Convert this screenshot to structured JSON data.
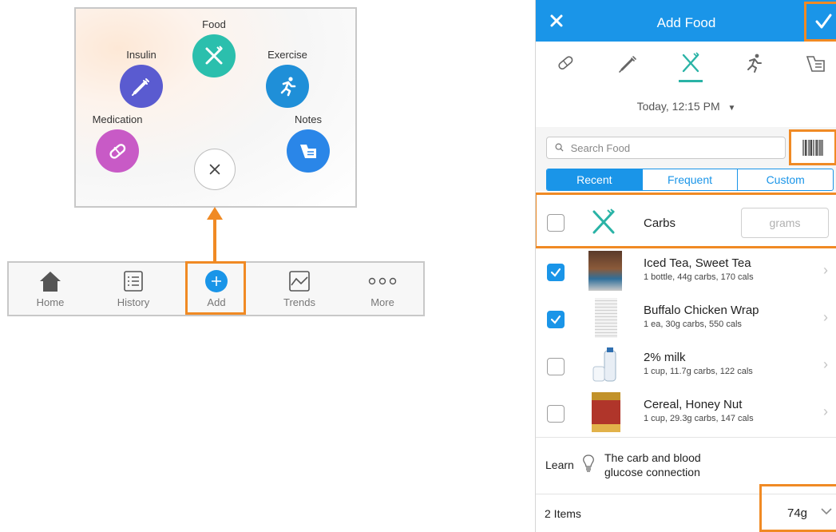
{
  "colors": {
    "accent_orange": "#f08a24",
    "nav_blue": "#1a95e8",
    "food_teal": "#2bbfad",
    "insulin_purple": "#5a5bd0",
    "exercise_blue": "#1f8fd8",
    "medication_pink": "#c85ac6",
    "notes_blue": "#2a86e8"
  },
  "add_menu": {
    "food_label": "Food",
    "food_icon": "fork-knife-icon",
    "insulin_label": "Insulin",
    "insulin_icon": "syringe-icon",
    "exercise_label": "Exercise",
    "exercise_icon": "runner-icon",
    "medication_label": "Medication",
    "medication_icon": "pill-icon",
    "notes_label": "Notes",
    "notes_icon": "notepad-icon",
    "close_icon": "close-icon"
  },
  "tab_bar": {
    "home": "Home",
    "history": "History",
    "add": "Add",
    "trends": "Trends",
    "more": "More"
  },
  "add_food": {
    "nav": {
      "title": "Add Food",
      "close_icon": "close-icon",
      "confirm_icon": "check-icon"
    },
    "categories": [
      "pill-icon",
      "syringe-icon",
      "fork-knife-icon",
      "runner-icon",
      "notepad-icon"
    ],
    "selected_category": "fork-knife-icon",
    "datetime": "Today, 12:15 PM",
    "search_placeholder": "Search Food",
    "segments": {
      "recent": "Recent",
      "frequent": "Frequent",
      "custom": "Custom",
      "selected": "Recent"
    },
    "carbs": {
      "label": "Carbs",
      "placeholder": "grams",
      "checked": false
    },
    "foods": [
      {
        "name": "Iced Tea, Sweet Tea",
        "detail": "1 bottle, 44g carbs, 170 cals",
        "checked": true
      },
      {
        "name": "Buffalo Chicken Wrap",
        "detail": "1 ea, 30g carbs, 550 cals",
        "checked": true
      },
      {
        "name": "2% milk",
        "detail": "1 cup, 11.7g carbs, 122 cals",
        "checked": false
      },
      {
        "name": "Cereal, Honey Nut",
        "detail": "1 cup, 29.3g carbs, 147 cals",
        "checked": false
      }
    ],
    "learn": {
      "prefix": "Learn",
      "link_line1": "The carb and blood",
      "link_line2": "glucose connection"
    },
    "footer": {
      "items": "2 Items",
      "total": "74g"
    }
  }
}
